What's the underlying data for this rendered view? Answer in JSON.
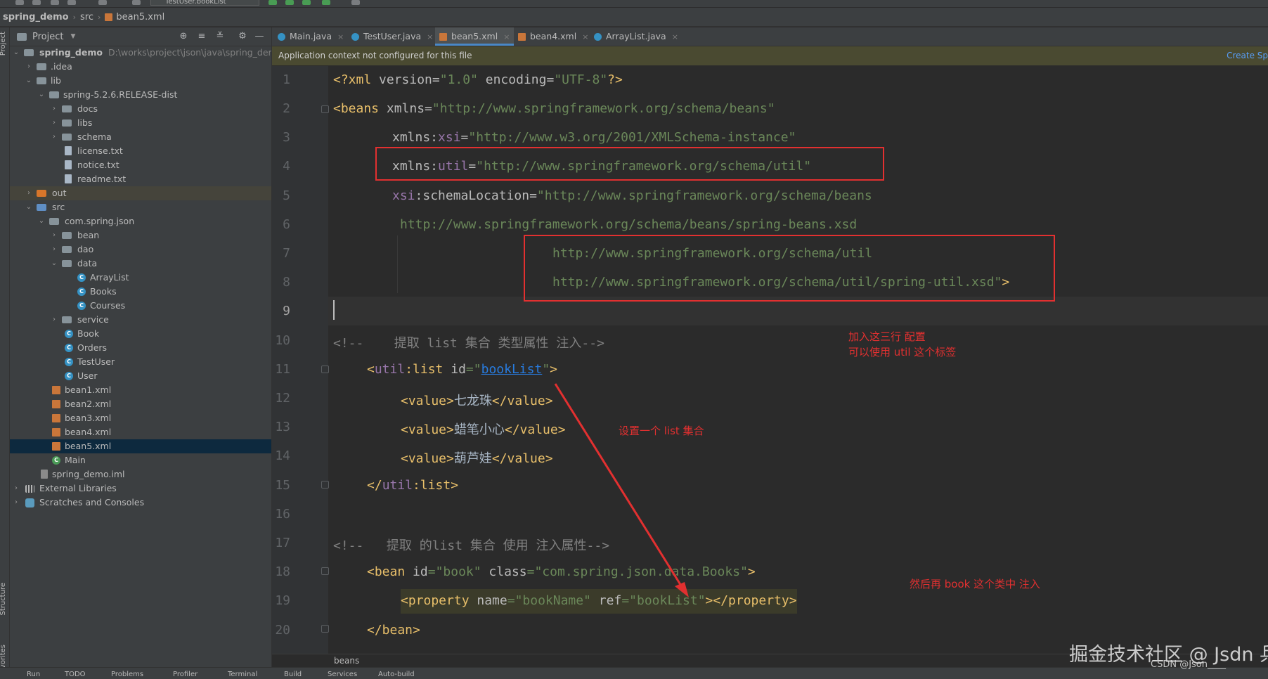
{
  "toolbar": {
    "run_config": "TestUser.bookList"
  },
  "breadcrumb": {
    "project": "spring_demo",
    "folder": "src",
    "file": "bean5.xml"
  },
  "side_strip": {
    "top": "Project",
    "structure": "Structure",
    "favorites": "Favorites"
  },
  "project_panel": {
    "title": "Project",
    "tree": [
      {
        "label": "spring_demo",
        "path": "D:\\works\\project\\json\\java\\spring_demo"
      },
      {
        "label": ".idea"
      },
      {
        "label": "lib"
      },
      {
        "label": "spring-5.2.6.RELEASE-dist"
      },
      {
        "label": "docs"
      },
      {
        "label": "libs"
      },
      {
        "label": "schema"
      },
      {
        "label": "license.txt"
      },
      {
        "label": "notice.txt"
      },
      {
        "label": "readme.txt"
      },
      {
        "label": "out"
      },
      {
        "label": "src"
      },
      {
        "label": "com.spring.json"
      },
      {
        "label": "bean"
      },
      {
        "label": "dao"
      },
      {
        "label": "data"
      },
      {
        "label": "ArrayList"
      },
      {
        "label": "Books"
      },
      {
        "label": "Courses"
      },
      {
        "label": "service"
      },
      {
        "label": "Book"
      },
      {
        "label": "Orders"
      },
      {
        "label": "TestUser"
      },
      {
        "label": "User"
      },
      {
        "label": "bean1.xml"
      },
      {
        "label": "bean2.xml"
      },
      {
        "label": "bean3.xml"
      },
      {
        "label": "bean4.xml"
      },
      {
        "label": "bean5.xml"
      },
      {
        "label": "Main"
      },
      {
        "label": "spring_demo.iml"
      },
      {
        "label": "External Libraries"
      },
      {
        "label": "Scratches and Consoles"
      }
    ]
  },
  "tabs": [
    {
      "label": "Main.java"
    },
    {
      "label": "TestUser.java"
    },
    {
      "label": "bean5.xml"
    },
    {
      "label": "bean4.xml"
    },
    {
      "label": "ArrayList.java"
    }
  ],
  "banner": {
    "text": "Application context not configured for this file",
    "link": "Create Sp"
  },
  "editor": {
    "line_numbers": [
      "1",
      "2",
      "3",
      "4",
      "5",
      "6",
      "7",
      "8",
      "9",
      "10",
      "11",
      "12",
      "13",
      "14",
      "15",
      "16",
      "17",
      "18",
      "19",
      "20"
    ],
    "code": {
      "l1": {
        "a": "<?xml ",
        "b": "version",
        "c": "=",
        "d": "\"1.0\"",
        "e": " encoding",
        "f": "=",
        "g": "\"UTF-8\"",
        "h": "?>"
      },
      "l2": {
        "a": "<beans ",
        "b": "xmlns",
        "c": "=",
        "d": "\"http://www.springframework.org/schema/beans\""
      },
      "l3": {
        "a": "xmlns:",
        "b": "xsi",
        "c": "=",
        "d": "\"http://www.w3.org/2001/XMLSchema-instance\""
      },
      "l4": {
        "a": "xmlns:",
        "b": "util",
        "c": "=",
        "d": "\"http://www.springframework.org/schema/util\""
      },
      "l5": {
        "a": "xsi",
        "b": ":schemaLocation",
        "c": "=",
        "d": "\"http://www.springframework.org/schema/beans"
      },
      "l6": "http://www.springframework.org/schema/beans/spring-beans.xsd",
      "l7": "http://www.springframework.org/schema/util",
      "l8": {
        "a": "http://www.springframework.org/schema/util/spring-util.xsd\"",
        "b": ">"
      },
      "l10": "<!--    提取 list 集合 类型属性 注入-->",
      "l11": {
        "a": "<",
        "b": "util",
        "c": ":list ",
        "d": "id",
        "e": "=\"",
        "f": "bookList",
        "g": "\"",
        "h": ">"
      },
      "l12": {
        "a": "<value>",
        "b": "七龙珠",
        "c": "</value>"
      },
      "l13": {
        "a": "<value>",
        "b": "蜡笔小心",
        "c": "</value>"
      },
      "l14": {
        "a": "<value>",
        "b": "葫芦娃",
        "c": "</value>"
      },
      "l15": {
        "a": "</",
        "b": "util",
        "c": ":list>"
      },
      "l17": "<!--   提取 的list 集合 使用 注入属性-->",
      "l18": {
        "a": "<bean ",
        "b": "id",
        "c": "=",
        "d": "\"book\"",
        "e": " class",
        "f": "=",
        "g": "\"com.spring.json.data.Books\"",
        "h": ">"
      },
      "l19": {
        "a": "<property ",
        "b": "name",
        "c": "=",
        "d": "\"bookName\"",
        "e": " ref",
        "f": "=",
        "g": "\"bookList\"",
        "h": "></property>"
      },
      "l20": "</bean>"
    }
  },
  "annotations": {
    "note1_line1": "加入这三行 配置",
    "note1_line2": "可以使用 util 这个标签",
    "note2": "设置一个 list 集合",
    "note3": "然后再 book 这个类中 注入"
  },
  "footer": {
    "context": "beans"
  },
  "statusbar": [
    "Run",
    "TODO",
    "Problems",
    "Profiler",
    "Terminal",
    "Build",
    "Services",
    "Auto-build"
  ],
  "watermark": {
    "main": "掘金技术社区 @ Jsdn 兵",
    "sub": "CSDN @Json____"
  },
  "colors": {
    "accent": "#4a88c7",
    "annotation": "#e23030",
    "selection": "#0d293e"
  }
}
